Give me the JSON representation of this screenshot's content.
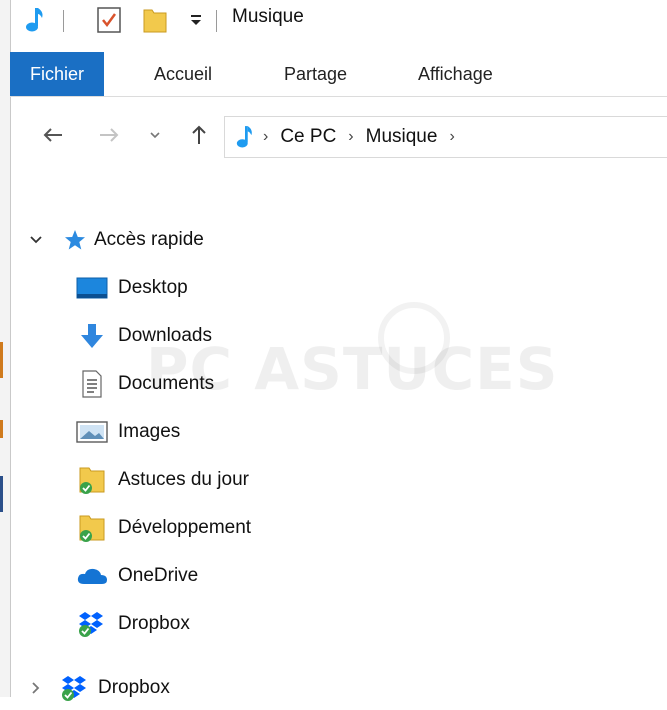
{
  "window": {
    "title": "Musique"
  },
  "ribbon": {
    "tabs": [
      "Fichier",
      "Accueil",
      "Partage",
      "Affichage"
    ]
  },
  "address": {
    "crumbs": [
      "Ce PC",
      "Musique"
    ]
  },
  "tree": {
    "quick_access": "Accès rapide",
    "items": [
      "Desktop",
      "Downloads",
      "Documents",
      "Images",
      "Astuces du jour",
      "Développement",
      "OneDrive",
      "Dropbox"
    ],
    "bottom": "Dropbox"
  },
  "watermark": "PC ASTUCES",
  "colors": {
    "accent": "#1a6fc4",
    "music": "#1e9bf0",
    "folder": "#f2c94c",
    "dropbox": "#0061fe"
  }
}
